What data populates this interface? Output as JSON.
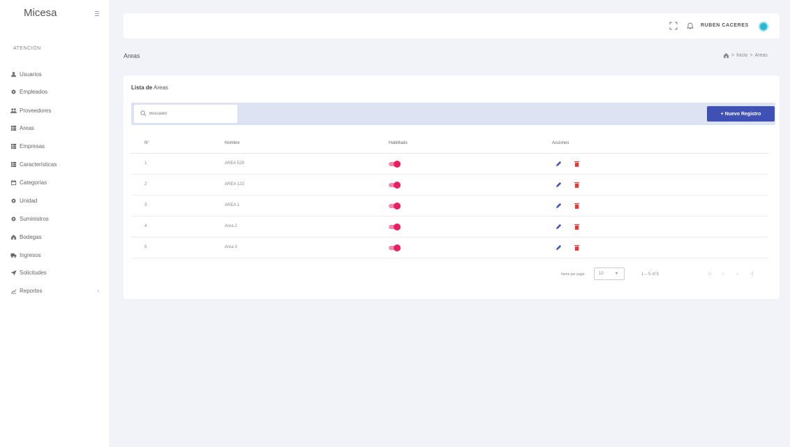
{
  "sidebar": {
    "brand": "Micesa",
    "section_label": "Atención",
    "items": [
      {
        "label": "Usuarios",
        "icon": "user-icon"
      },
      {
        "label": "Empleados",
        "icon": "gear-icon"
      },
      {
        "label": "Proveedores",
        "icon": "team-icon"
      },
      {
        "label": "Areas",
        "icon": "grid-icon"
      },
      {
        "label": "Empresas",
        "icon": "grid-icon"
      },
      {
        "label": "Características",
        "icon": "grid-icon"
      },
      {
        "label": "Categorías",
        "icon": "calendar-icon"
      },
      {
        "label": "Unidad",
        "icon": "gear-icon"
      },
      {
        "label": "Suministros",
        "icon": "gear-icon"
      },
      {
        "label": "Bodegas",
        "icon": "home-icon"
      },
      {
        "label": "Ingresos",
        "icon": "truck-icon"
      },
      {
        "label": "Solicitudes",
        "icon": "send-icon"
      },
      {
        "label": "Reportes",
        "icon": "chart-icon"
      }
    ]
  },
  "header": {
    "user_name": "RUBEN CACERES"
  },
  "page": {
    "title": "Areas",
    "breadcrumb": [
      "Inicio",
      "Areas"
    ]
  },
  "card": {
    "title_bold": "Lista de",
    "title_rest": "Areas",
    "search_placeholder": "Buscador",
    "new_button_label": "+ Nuevo Registro"
  },
  "table": {
    "headers": [
      "N°",
      "Nombre",
      "Habilitado",
      "Acciones"
    ],
    "rows": [
      {
        "num": "1",
        "name": "AREA 529",
        "enabled": true
      },
      {
        "num": "2",
        "name": "AREA 123",
        "enabled": true
      },
      {
        "num": "3",
        "name": "AREA 1",
        "enabled": true
      },
      {
        "num": "4",
        "name": "Area 2",
        "enabled": true
      },
      {
        "num": "5",
        "name": "Area 3",
        "enabled": true
      }
    ]
  },
  "pagination": {
    "items_per_page_label": "Items per page:",
    "items_per_page_value": "10",
    "range_label": "1 – 5 of 5"
  },
  "colors": {
    "primary": "#3f51b5",
    "toggle_on": "#e91e63",
    "delete": "#e53935",
    "edit": "#3f51b5",
    "avatar": "#29b6d6"
  }
}
